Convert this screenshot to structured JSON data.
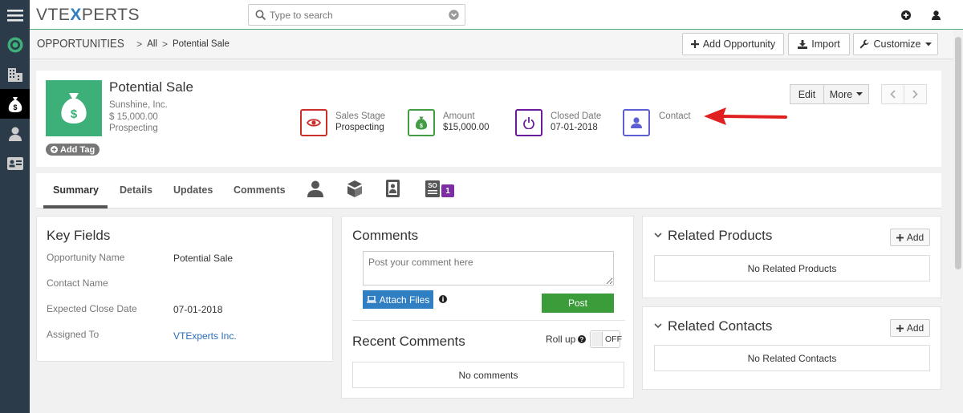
{
  "app": {
    "logo_pre": "VTE",
    "logo_x": "X",
    "logo_post": "PERTS",
    "search_placeholder": "Type to search"
  },
  "breadcrumb": {
    "module": "OPPORTUNITIES",
    "sep1": ">",
    "filter": "All",
    "sep2": ">",
    "record": "Potential Sale"
  },
  "toolbar": {
    "add_label": "Add Opportunity",
    "import_label": "Import",
    "customize_label": "Customize"
  },
  "record": {
    "name": "Potential Sale",
    "org": "Sunshine, Inc.",
    "amount_line": "$ 15,000.00",
    "stage_line": "Prospecting",
    "add_tag": "Add Tag",
    "edit": "Edit",
    "more": "More"
  },
  "key_fields_header": [
    {
      "label": "Sales Stage",
      "value": "Prospecting",
      "color": "#c9302c"
    },
    {
      "label": "Amount",
      "value": "$15,000.00",
      "color": "#449d44"
    },
    {
      "label": "Closed Date",
      "value": "07-01-2018",
      "color": "#6a1b9a"
    },
    {
      "label": "Contact",
      "value": "",
      "color": "#5b5fd1"
    }
  ],
  "tabs": {
    "summary": "Summary",
    "details": "Details",
    "updates": "Updates",
    "comments": "Comments",
    "badge": "1"
  },
  "key_fields": {
    "title": "Key Fields",
    "rows": [
      {
        "label": "Opportunity Name",
        "value": "Potential Sale"
      },
      {
        "label": "Contact Name",
        "value": ""
      },
      {
        "label": "Expected Close Date",
        "value": "07-01-2018"
      },
      {
        "label": "Assigned To",
        "value": "VTExperts Inc."
      }
    ]
  },
  "comments": {
    "title": "Comments",
    "placeholder": "Post your comment here",
    "attach": "Attach Files",
    "post": "Post",
    "recent_title": "Recent Comments",
    "rollup": "Roll up",
    "toggle": "OFF",
    "empty": "No comments"
  },
  "related_products": {
    "title": "Related Products",
    "add": "Add",
    "empty": "No Related Products"
  },
  "related_contacts": {
    "title": "Related Contacts",
    "add": "Add",
    "empty": "No Related Contacts"
  },
  "colors": {
    "green": "#3db07a",
    "blue": "#2f7fc2",
    "link": "#2a6ebb",
    "arrow": "#e02020"
  }
}
